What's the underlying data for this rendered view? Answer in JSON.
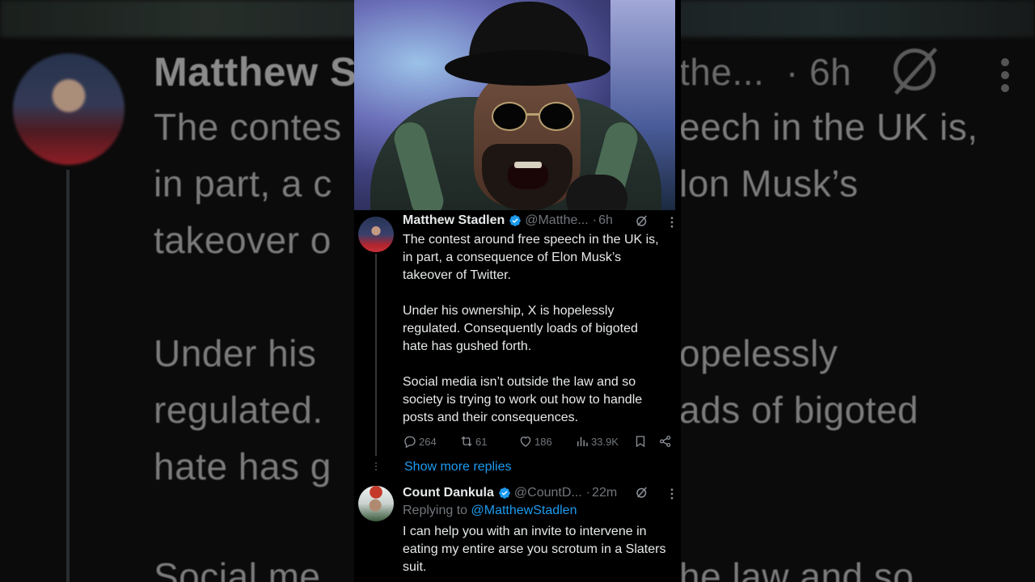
{
  "background": {
    "name_fragment": "Matthew S",
    "handle_fragment": "the...",
    "time": "· 6h",
    "left_lines": [
      "The contes",
      "in part, a c",
      "takeover o",
      "Under his",
      "regulated.",
      "hate has g",
      "Social me"
    ],
    "right_lines": [
      "eech in the UK is,",
      "lon Musk’s",
      "opelessly",
      "ads of bigoted",
      "he law and so"
    ]
  },
  "tweet1": {
    "name": "Matthew Stadlen",
    "handle": "@Matthe...",
    "time": "6h",
    "paragraphs": [
      "The contest around free speech in the UK is,\nin part, a consequence of Elon Musk’s\ntakeover of Twitter.",
      "Under his ownership, X is hopelessly\nregulated. Consequently loads of bigoted\nhate has gushed forth.",
      "Social media isn’t outside the law and so\nsociety is trying to work out how to handle\nposts and their consequences."
    ],
    "stats": {
      "replies": "264",
      "reposts": "61",
      "likes": "186",
      "views": "33.9K"
    }
  },
  "show_more": "Show more replies",
  "tweet2": {
    "name": "Count Dankula",
    "handle": "@CountD...",
    "time": "22m",
    "replying_prefix": "Replying to",
    "replying_to": "@MatthewStadlen",
    "text": "I can help you with an invite to intervene in\neating my entire arse you scrotum in a Slaters\nsuit."
  },
  "icons": {
    "verified": "verified-badge-icon",
    "grok": "grok-icon",
    "more": "more-options-icon",
    "reply": "reply-icon",
    "repost": "repost-icon",
    "like": "like-icon",
    "views": "views-icon",
    "bookmark": "bookmark-icon",
    "share": "share-icon"
  },
  "colors": {
    "accent": "#1d9bf0",
    "muted": "#71767b",
    "text": "#e7e9ea",
    "background": "#000000"
  }
}
